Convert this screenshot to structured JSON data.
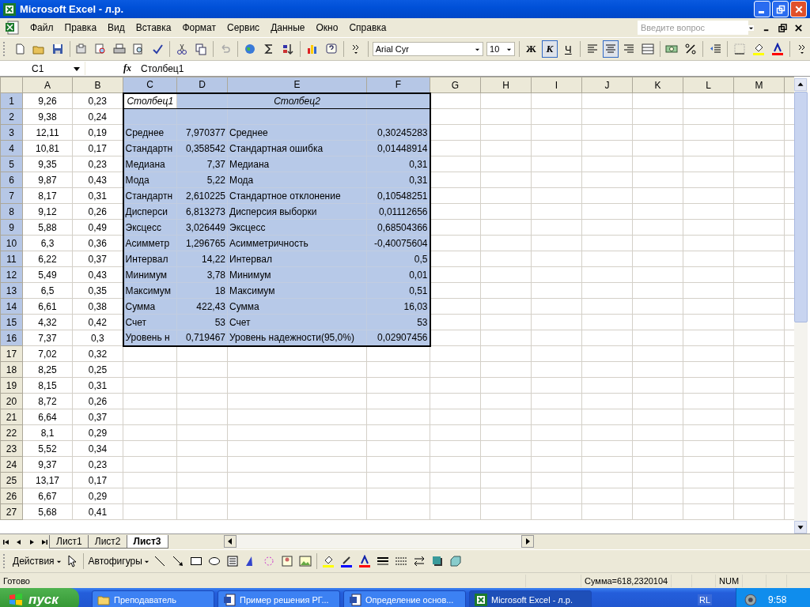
{
  "window": {
    "title": "Microsoft Excel - л.р."
  },
  "menu": [
    "Файл",
    "Правка",
    "Вид",
    "Вставка",
    "Формат",
    "Сервис",
    "Данные",
    "Окно",
    "Справка"
  ],
  "help_search": {
    "placeholder": "Введите вопрос"
  },
  "toolbar": {
    "font": "Arial Cyr",
    "size": "10",
    "styles": [
      {
        "label": "Ж",
        "selected": false
      },
      {
        "label": "К",
        "selected": true
      },
      {
        "label": "Ч",
        "selected": false
      }
    ],
    "align": [
      {
        "kind": "left",
        "selected": false
      },
      {
        "kind": "center",
        "selected": true
      },
      {
        "kind": "right",
        "selected": false
      },
      {
        "kind": "merge",
        "selected": false
      }
    ]
  },
  "formula_bar": {
    "name_box": "C1",
    "fx": "fx",
    "value": "Столбец1"
  },
  "columns": [
    {
      "label": "A",
      "selected": false
    },
    {
      "label": "B",
      "selected": false
    },
    {
      "label": "C",
      "selected": true
    },
    {
      "label": "D",
      "selected": true
    },
    {
      "label": "E",
      "selected": true
    },
    {
      "label": "F",
      "selected": true
    },
    {
      "label": "G",
      "selected": false
    },
    {
      "label": "H",
      "selected": false
    },
    {
      "label": "I",
      "selected": false
    },
    {
      "label": "J",
      "selected": false
    },
    {
      "label": "K",
      "selected": false
    },
    {
      "label": "L",
      "selected": false
    },
    {
      "label": "M",
      "selected": false
    }
  ],
  "rows": [
    {
      "number": "1",
      "selected": true,
      "kind": "header",
      "a": "9,26",
      "b": "0,23",
      "c": "Столбец1",
      "e": "Столбец2"
    },
    {
      "number": "2",
      "selected": true,
      "kind": "data",
      "a": "9,38",
      "b": "0,24"
    },
    {
      "number": "3",
      "selected": true,
      "kind": "data",
      "a": "12,11",
      "b": "0,19",
      "c": "Среднее",
      "d": "7,970377",
      "e": "Среднее",
      "f": "0,30245283"
    },
    {
      "number": "4",
      "selected": true,
      "kind": "data",
      "a": "10,81",
      "b": "0,17",
      "c": "Стандартн",
      "d": "0,358542",
      "e": "Стандартная ошибка",
      "f": "0,01448914"
    },
    {
      "number": "5",
      "selected": true,
      "kind": "data",
      "a": "9,35",
      "b": "0,23",
      "c": "Медиана",
      "d": "7,37",
      "e": "Медиана",
      "f": "0,31"
    },
    {
      "number": "6",
      "selected": true,
      "kind": "data",
      "a": "9,87",
      "b": "0,43",
      "c": "Мода",
      "d": "5,22",
      "e": "Мода",
      "f": "0,31"
    },
    {
      "number": "7",
      "selected": true,
      "kind": "data",
      "a": "8,17",
      "b": "0,31",
      "c": "Стандартн",
      "d": "2,610225",
      "e": "Стандартное отклонение",
      "f": "0,10548251"
    },
    {
      "number": "8",
      "selected": true,
      "kind": "data",
      "a": "9,12",
      "b": "0,26",
      "c": "Дисперси",
      "d": "6,813273",
      "e": "Дисперсия выборки",
      "f": "0,01112656"
    },
    {
      "number": "9",
      "selected": true,
      "kind": "data",
      "a": "5,88",
      "b": "0,49",
      "c": "Эксцесс",
      "d": "3,026449",
      "e": "Эксцесс",
      "f": "0,68504366"
    },
    {
      "number": "10",
      "selected": true,
      "kind": "data",
      "a": "6,3",
      "b": "0,36",
      "c": "Асимметр",
      "d": "1,296765",
      "e": "Асимметричность",
      "f": "-0,40075604"
    },
    {
      "number": "11",
      "selected": true,
      "kind": "data",
      "a": "6,22",
      "b": "0,37",
      "c": "Интервал",
      "d": "14,22",
      "e": "Интервал",
      "f": "0,5"
    },
    {
      "number": "12",
      "selected": true,
      "kind": "data",
      "a": "5,49",
      "b": "0,43",
      "c": "Минимум",
      "d": "3,78",
      "e": "Минимум",
      "f": "0,01"
    },
    {
      "number": "13",
      "selected": true,
      "kind": "data",
      "a": "6,5",
      "b": "0,35",
      "c": "Максимум",
      "d": "18",
      "e": "Максимум",
      "f": "0,51"
    },
    {
      "number": "14",
      "selected": true,
      "kind": "data",
      "a": "6,61",
      "b": "0,38",
      "c": "Сумма",
      "d": "422,43",
      "e": "Сумма",
      "f": "16,03"
    },
    {
      "number": "15",
      "selected": true,
      "kind": "data",
      "a": "4,32",
      "b": "0,42",
      "c": "Счет",
      "d": "53",
      "e": "Счет",
      "f": "53"
    },
    {
      "number": "16",
      "selected": true,
      "kind": "data",
      "a": "7,37",
      "b": "0,3",
      "c": "Уровень н",
      "d": "0,719467",
      "e": "Уровень надежности(95,0%)",
      "f": "0,02907456"
    },
    {
      "number": "17",
      "selected": false,
      "kind": "data",
      "a": "7,02",
      "b": "0,32"
    },
    {
      "number": "18",
      "selected": false,
      "kind": "data",
      "a": "8,25",
      "b": "0,25"
    },
    {
      "number": "19",
      "selected": false,
      "kind": "data",
      "a": "8,15",
      "b": "0,31"
    },
    {
      "number": "20",
      "selected": false,
      "kind": "data",
      "a": "8,72",
      "b": "0,26"
    },
    {
      "number": "21",
      "selected": false,
      "kind": "data",
      "a": "6,64",
      "b": "0,37"
    },
    {
      "number": "22",
      "selected": false,
      "kind": "data",
      "a": "8,1",
      "b": "0,29"
    },
    {
      "number": "23",
      "selected": false,
      "kind": "data",
      "a": "5,52",
      "b": "0,34"
    },
    {
      "number": "24",
      "selected": false,
      "kind": "data",
      "a": "9,37",
      "b": "0,23"
    },
    {
      "number": "25",
      "selected": false,
      "kind": "data",
      "a": "13,17",
      "b": "0,17"
    },
    {
      "number": "26",
      "selected": false,
      "kind": "data",
      "a": "6,67",
      "b": "0,29"
    },
    {
      "number": "27",
      "selected": false,
      "kind": "data",
      "a": "5,68",
      "b": "0,41"
    }
  ],
  "sheet_tabs": [
    {
      "label": "Лист1",
      "selected": false
    },
    {
      "label": "Лист2",
      "selected": false
    },
    {
      "label": "Лист3",
      "selected": true
    }
  ],
  "drawing_toolbar": {
    "actions": "Действия",
    "autoshapes": "Автофигуры"
  },
  "status_bar": {
    "status": "Готово",
    "sum": "Сумма=618,2320104",
    "num": "NUM"
  },
  "taskbar": {
    "start": "пуск",
    "tasks": [
      {
        "label": "Преподаватель",
        "kind": "folder",
        "selected": false
      },
      {
        "label": "Пример решения РГ...",
        "kind": "word",
        "selected": false
      },
      {
        "label": "Определение основ...",
        "kind": "word",
        "selected": false
      },
      {
        "label": "Microsoft Excel - л.р.",
        "kind": "excel",
        "selected": true
      }
    ],
    "language": "RL",
    "clock": "9:58"
  }
}
